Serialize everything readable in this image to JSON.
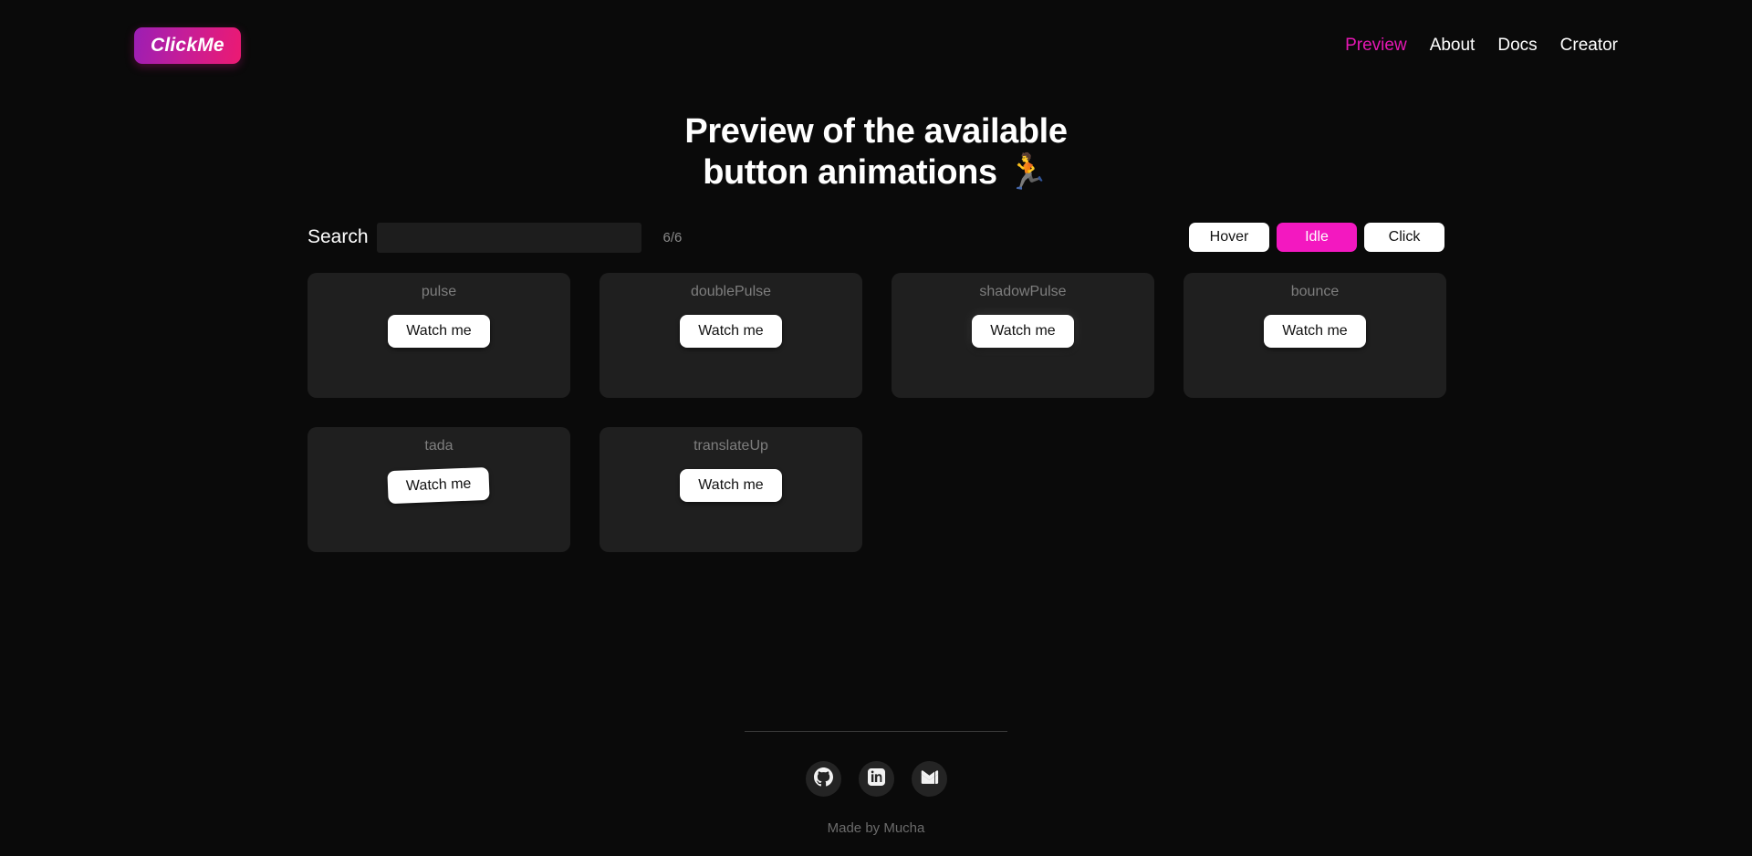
{
  "header": {
    "logo_text": "ClickMe",
    "nav": [
      {
        "label": "Preview",
        "active": true
      },
      {
        "label": "About",
        "active": false
      },
      {
        "label": "Docs",
        "active": false
      },
      {
        "label": "Creator",
        "active": false
      }
    ]
  },
  "main": {
    "title_line1": "Preview of the available",
    "title_line2": "button animations 🏃",
    "search": {
      "label": "Search",
      "value": "",
      "placeholder": ""
    },
    "count": "6/6",
    "modes": [
      {
        "label": "Hover",
        "active": false
      },
      {
        "label": "Idle",
        "active": true
      },
      {
        "label": "Click",
        "active": false
      }
    ],
    "cards": [
      {
        "name": "pulse",
        "button_label": "Watch me"
      },
      {
        "name": "doublePulse",
        "button_label": "Watch me"
      },
      {
        "name": "shadowPulse",
        "button_label": "Watch me"
      },
      {
        "name": "bounce",
        "button_label": "Watch me"
      },
      {
        "name": "tada",
        "button_label": "Watch me"
      },
      {
        "name": "translateUp",
        "button_label": "Watch me"
      }
    ]
  },
  "footer": {
    "socials": [
      {
        "icon": "github-icon"
      },
      {
        "icon": "linkedin-icon"
      },
      {
        "icon": "gmail-icon"
      }
    ],
    "made_by": "Made by Mucha"
  },
  "colors": {
    "background": "#0a0a0a",
    "card": "#1f1f1f",
    "accent_pink": "#f318c0",
    "nav_active": "#e617b4",
    "logo_gradient_start": "#9b1fb4",
    "logo_gradient_end": "#ec1a72",
    "muted_text": "#7e7e7e"
  }
}
